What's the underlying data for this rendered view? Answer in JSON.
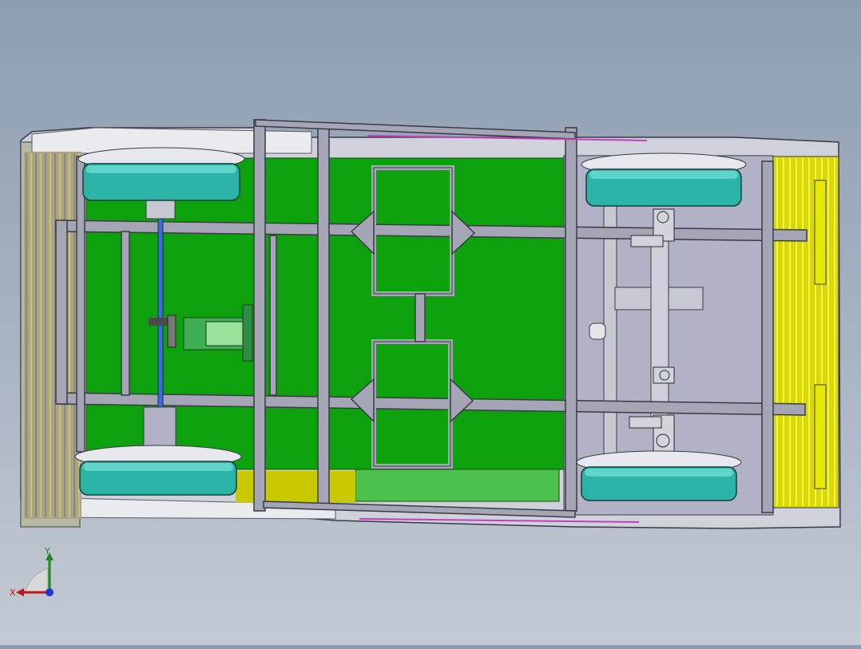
{
  "viewport": {
    "background_top": "#8d9db1",
    "background_bottom": "#c4cad4",
    "model": {
      "colors": {
        "floor_panel": "#0da20d",
        "floor_panel_light": "#4cc24c",
        "frame_steel": "#a4a6b6",
        "frame_edge": "#3a3a44",
        "wheel": "#2ab3a6",
        "wheel_top": "#5fd4c8",
        "body_shell": "#e4e6ea",
        "body_panel": "#c6c8d2",
        "bumper_yellow": "#d9d900",
        "drive_shaft": "#3a6fd0",
        "motor": "#3fae55",
        "trim_magenta": "#c040c0"
      },
      "wheels": [
        {
          "name": "rear-left-wheel"
        },
        {
          "name": "rear-right-wheel"
        },
        {
          "name": "front-left-wheel"
        },
        {
          "name": "front-right-wheel"
        }
      ]
    }
  },
  "triad": {
    "x_label": "X",
    "y_label": "Y",
    "colors": {
      "x": "#c01818",
      "y": "#1a8a1a",
      "z": "#1a3ad0",
      "plane": "#d8d8d8"
    }
  }
}
